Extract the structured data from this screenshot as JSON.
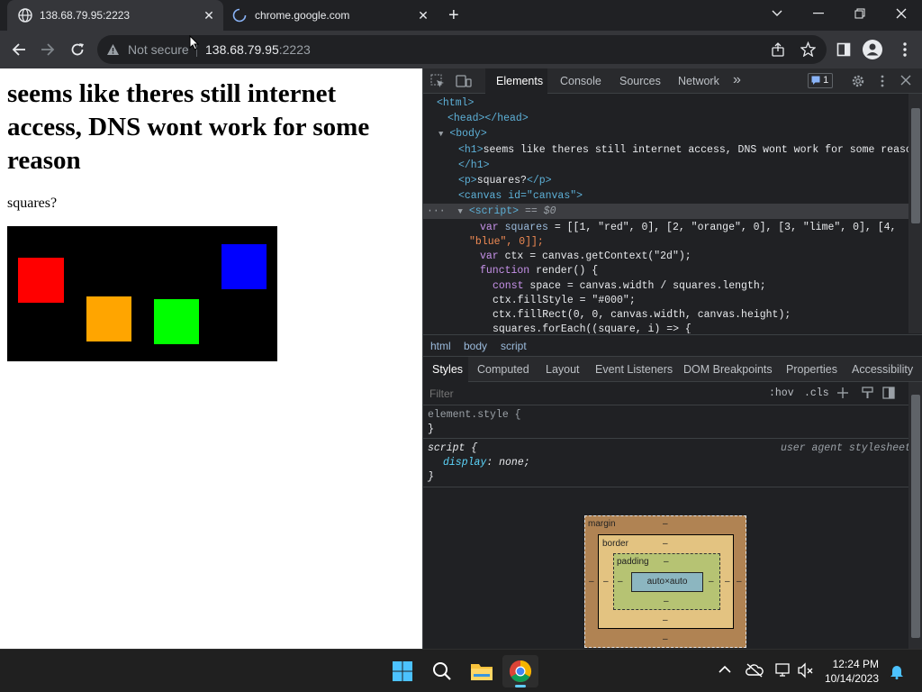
{
  "browser": {
    "tabs": [
      {
        "title": "138.68.79.95:2223",
        "active": true
      },
      {
        "title": "chrome.google.com",
        "active": false
      }
    ],
    "new_tab_label": "+",
    "address": {
      "security_text": "Not secure",
      "host": "138.68.79.95",
      "port": ":2223"
    }
  },
  "page": {
    "heading": "seems like theres still internet access, DNS wont work for some reason",
    "paragraph": "squares?",
    "canvas": {
      "background": "#000000",
      "squares": [
        {
          "index": 1,
          "color": "red",
          "hex": "#ff0000"
        },
        {
          "index": 2,
          "color": "orange",
          "hex": "#ffa500"
        },
        {
          "index": 3,
          "color": "lime",
          "hex": "#00ff00"
        },
        {
          "index": 4,
          "color": "blue",
          "hex": "#0000ff"
        }
      ]
    }
  },
  "devtools": {
    "tabs": [
      "Elements",
      "Console",
      "Sources",
      "Network"
    ],
    "more_tabs": "»",
    "issues_badge": "1",
    "dom": {
      "html_open": "<html>",
      "head": "<head></head>",
      "body_open": "<body>",
      "h1_open": "<h1>",
      "h1_text": "seems like theres still internet access, DNS wont work for some reason",
      "h1_close": "</h1>",
      "p_open": "<p>",
      "p_text": "squares?",
      "p_close": "</p>",
      "canvas_tag": "<canvas id=\"canvas\">",
      "script_tag": "<script>",
      "script_marker": "== $0",
      "ellipsis": "···",
      "code": {
        "line1_kw": "var",
        "line1_name": "squares",
        "line1_rest": " = [[1, \"red\", 0], [2, \"orange\", 0], [3, \"lime\", 0], [4,",
        "line2": "\"blue\", 0]];",
        "line3_kw": "var",
        "line3_rest": " ctx = canvas.getContext(\"2d\");",
        "line4_kw": "function",
        "line4_rest": " render() {",
        "line5_kw": "const",
        "line5_rest": " space = canvas.width / squares.length;",
        "line6": "ctx.fillStyle = \"#000\";",
        "line7": "ctx.fillRect(0, 0, canvas.width, canvas.height);",
        "line8": "squares.forEach((square, i) => {"
      }
    },
    "breadcrumbs": [
      "html",
      "body",
      "script"
    ],
    "panel_tabs": [
      "Styles",
      "Computed",
      "Layout",
      "Event Listeners",
      "DOM Breakpoints",
      "Properties",
      "Accessibility"
    ],
    "filter_placeholder": "Filter",
    "hov_label": ":hov",
    "cls_label": ".cls",
    "styles": {
      "element_style_selector": "element.style {",
      "element_style_close": "}",
      "script_selector": "script {",
      "script_source": "user agent stylesheet",
      "script_prop": "display",
      "script_value": "none;",
      "script_close": "}"
    },
    "box_model": {
      "margin_label": "margin",
      "border_label": "border",
      "padding_label": "padding",
      "content": "auto×auto",
      "dash": "–"
    }
  },
  "taskbar": {
    "time": "12:24 PM",
    "date": "10/14/2023"
  },
  "colors": {
    "accent": "#8ab4f8",
    "tab_active": "#35363a",
    "window": "#202124"
  }
}
